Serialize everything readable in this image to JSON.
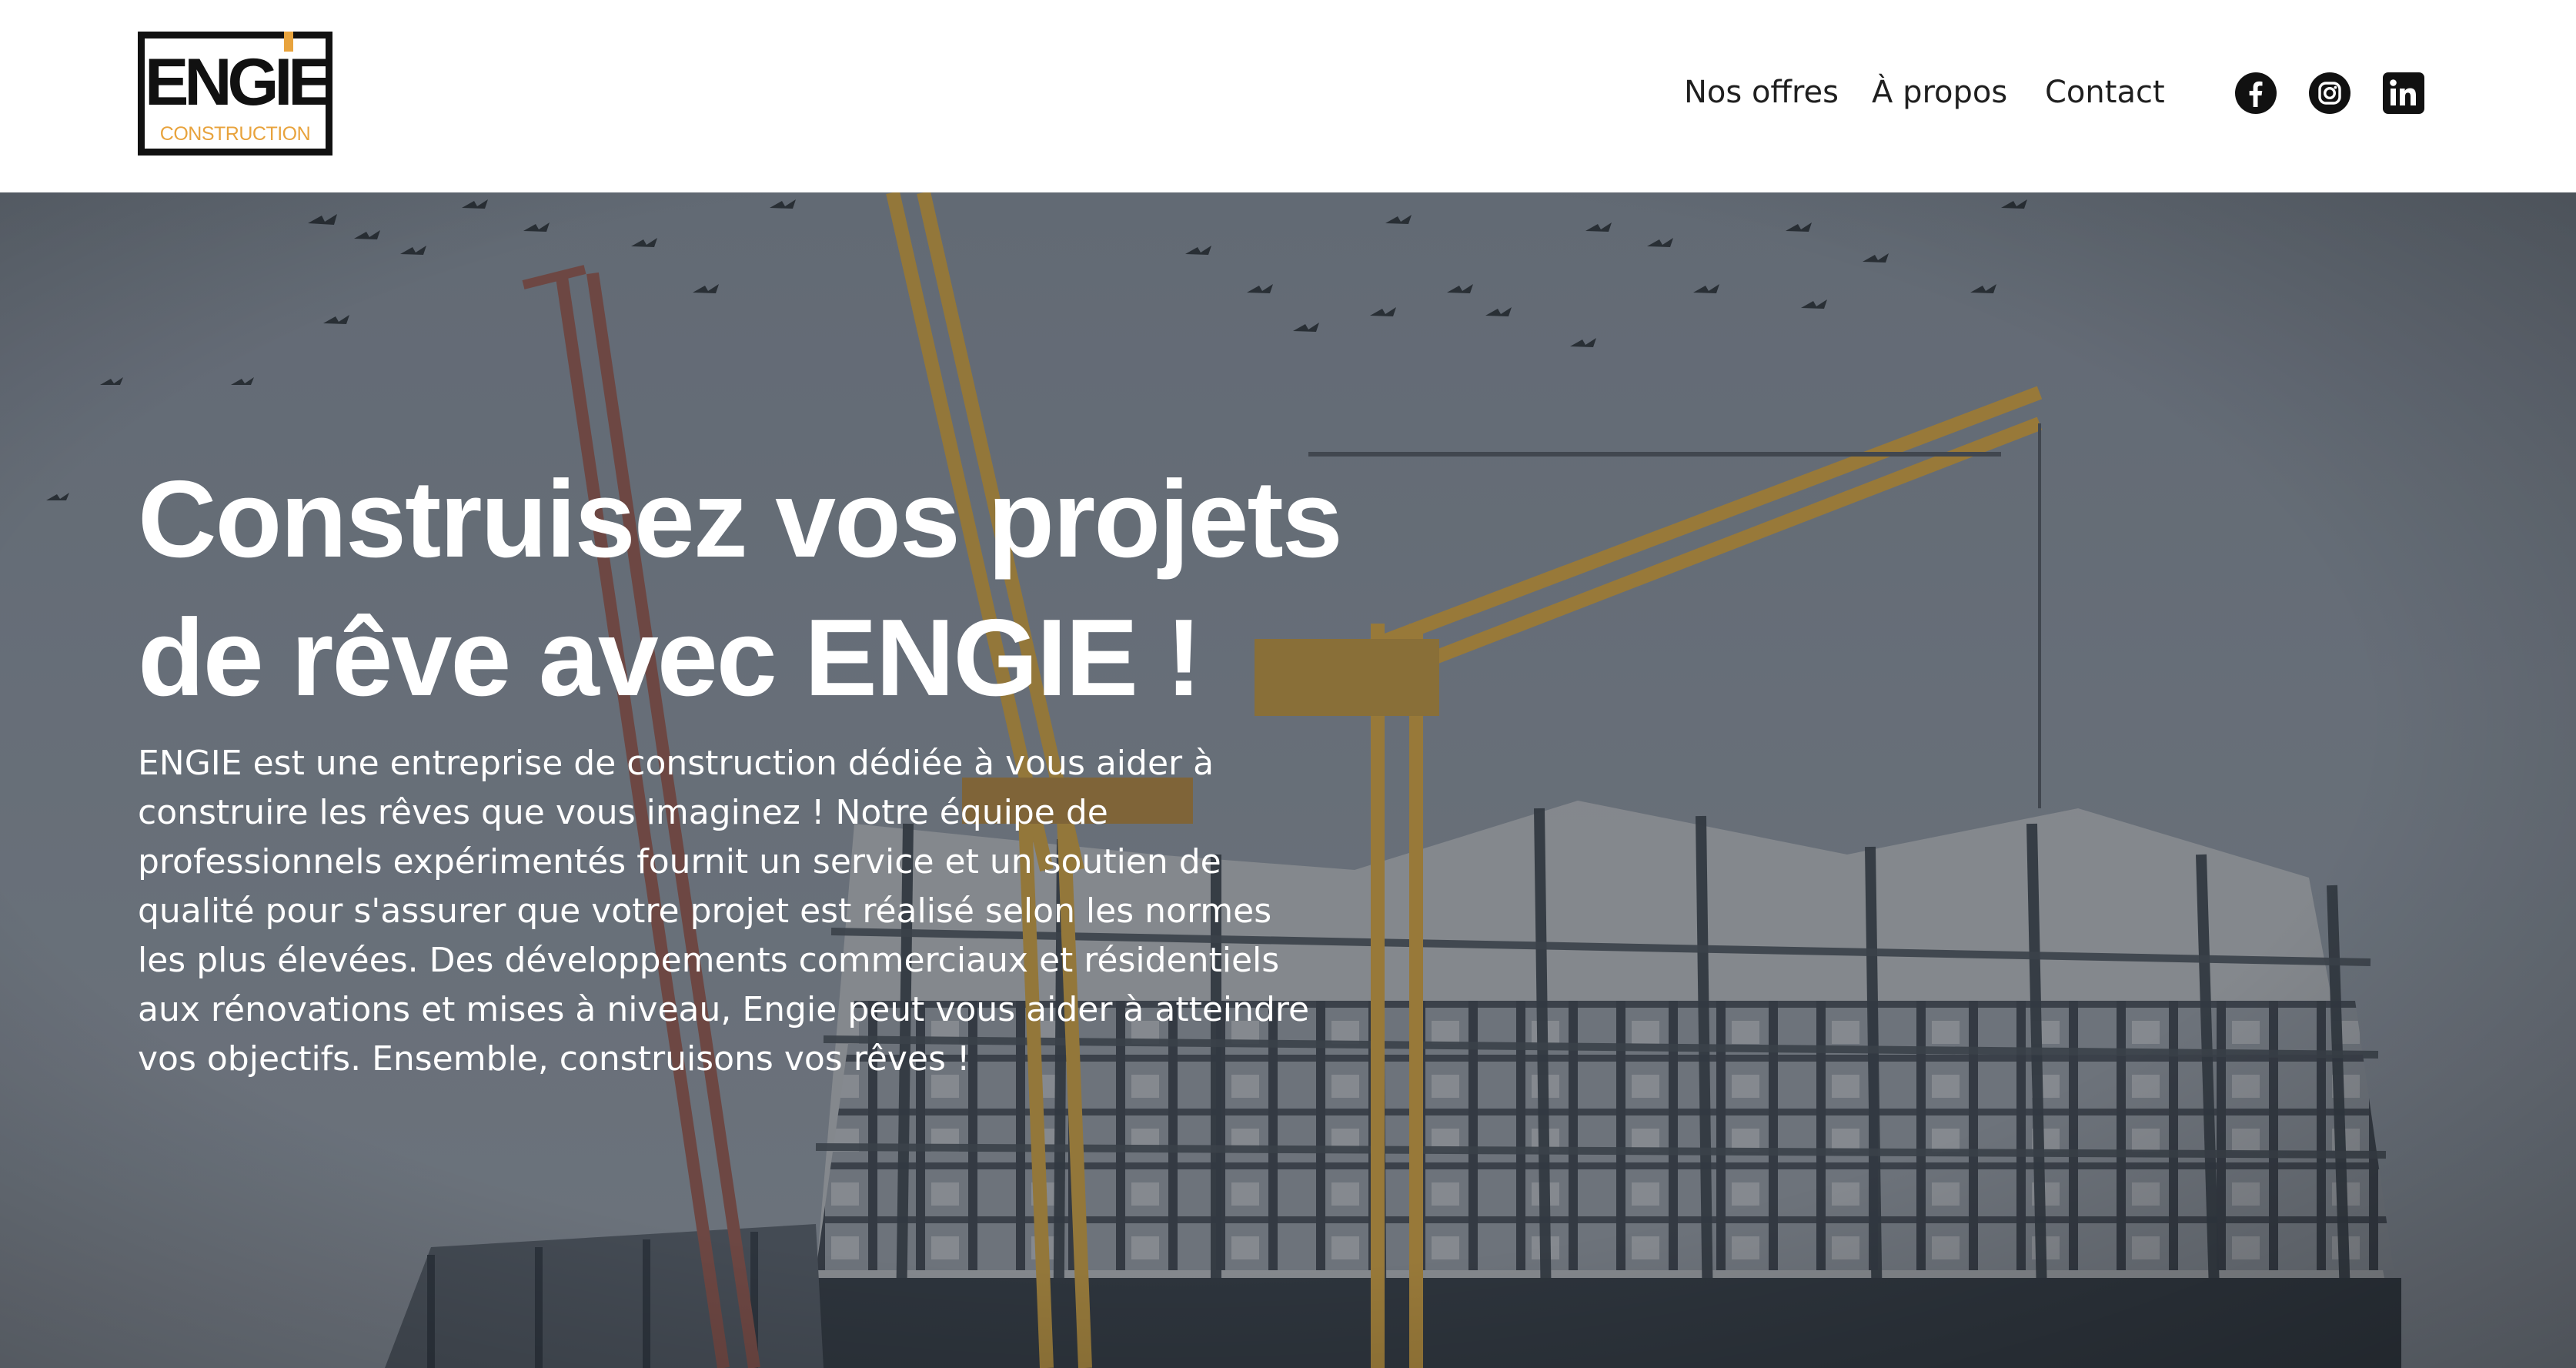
{
  "logo": {
    "word": "ENGIE",
    "subtitle": "CONSTRUCTION",
    "accent_color": "#e8a33d"
  },
  "nav": {
    "items": [
      "Nos offres",
      "À propos",
      "Contact"
    ]
  },
  "social": {
    "icons": [
      "facebook-icon",
      "instagram-icon",
      "linkedin-icon"
    ]
  },
  "hero": {
    "title_line1": "Construisez vos projets",
    "title_line2": "de rêve avec ENGIE !",
    "body": "ENGIE est une entreprise de construction dédiée à vous aider à construire les rêves que vous imaginez ! Notre équipe de professionnels expérimentés fournit un service et un soutien de qualité pour s'assurer que votre projet est réalisé selon les normes les plus élevées. Des développements commerciaux et résidentiels aux rénovations et mises à niveau, Engie peut vous aider à atteindre vos objectifs. Ensemble, construisons vos rêves !"
  },
  "colors": {
    "text_dark": "#1f1f1f",
    "hero_overlay": "#5d6670",
    "crane": "#c9962e"
  }
}
